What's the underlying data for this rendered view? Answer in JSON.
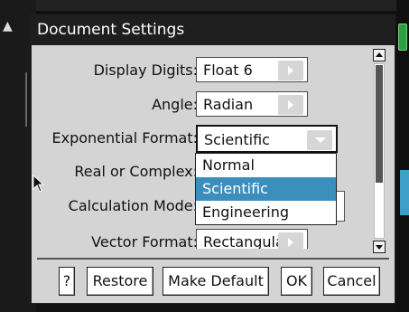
{
  "dialog": {
    "title": "Document Settings"
  },
  "fields": {
    "display_digits": {
      "label": "Display Digits:",
      "value": "Float 6"
    },
    "angle": {
      "label": "Angle:",
      "value": "Radian"
    },
    "exponential_format": {
      "label": "Exponential Format:",
      "value": "Scientific"
    },
    "real_or_complex": {
      "label": "Real or Complex:"
    },
    "calculation_mode": {
      "label": "Calculation Mode:"
    },
    "vector_format": {
      "label": "Vector Format:",
      "value": "Rectangular"
    }
  },
  "dropdown": {
    "options": [
      "Normal",
      "Scientific",
      "Engineering"
    ],
    "selected_index": 1
  },
  "buttons": {
    "help": "?",
    "restore": "Restore",
    "make_default": "Make Default",
    "ok": "OK",
    "cancel": "Cancel"
  },
  "colors": {
    "title_bar": "#1e1e1e",
    "dialog_bg": "#d4d4d4",
    "selection": "#3c8fbd"
  },
  "icons": {
    "scroll_up": "chevron-up-icon",
    "scroll_down": "chevron-down-icon",
    "pointer": "mouse-pointer-icon"
  }
}
